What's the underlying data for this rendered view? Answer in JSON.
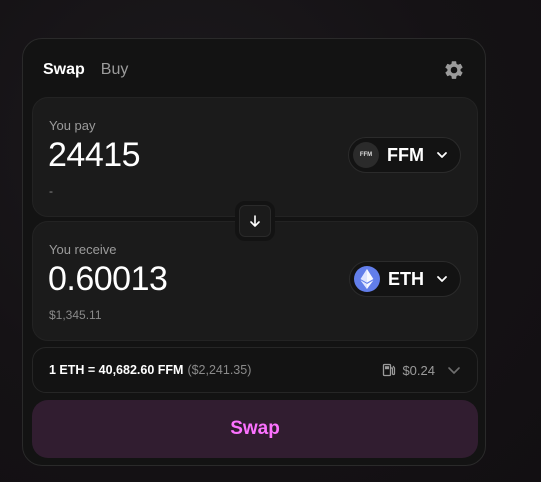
{
  "tabs": [
    {
      "label": "Swap",
      "active": true
    },
    {
      "label": "Buy",
      "active": false
    }
  ],
  "settings_icon": "gear-icon",
  "pay": {
    "label": "You pay",
    "amount": "24415",
    "usd_value": "-",
    "token": {
      "symbol": "FFM",
      "icon_text": "FFM"
    }
  },
  "flip_icon": "arrow-down-icon",
  "receive": {
    "label": "You receive",
    "amount": "0.60013",
    "usd_value": "$1,345.11",
    "token": {
      "symbol": "ETH",
      "icon": "eth-logo-icon"
    }
  },
  "rate": {
    "text": "1 ETH = 40,682.60 FFM",
    "usd": "($2,241.35)",
    "gas_fee": "$0.24"
  },
  "swap_button_label": "Swap",
  "colors": {
    "accent_pink": "#fc72ff",
    "swap_button_bg": "#311d30",
    "eth_blue": "#627eea"
  }
}
